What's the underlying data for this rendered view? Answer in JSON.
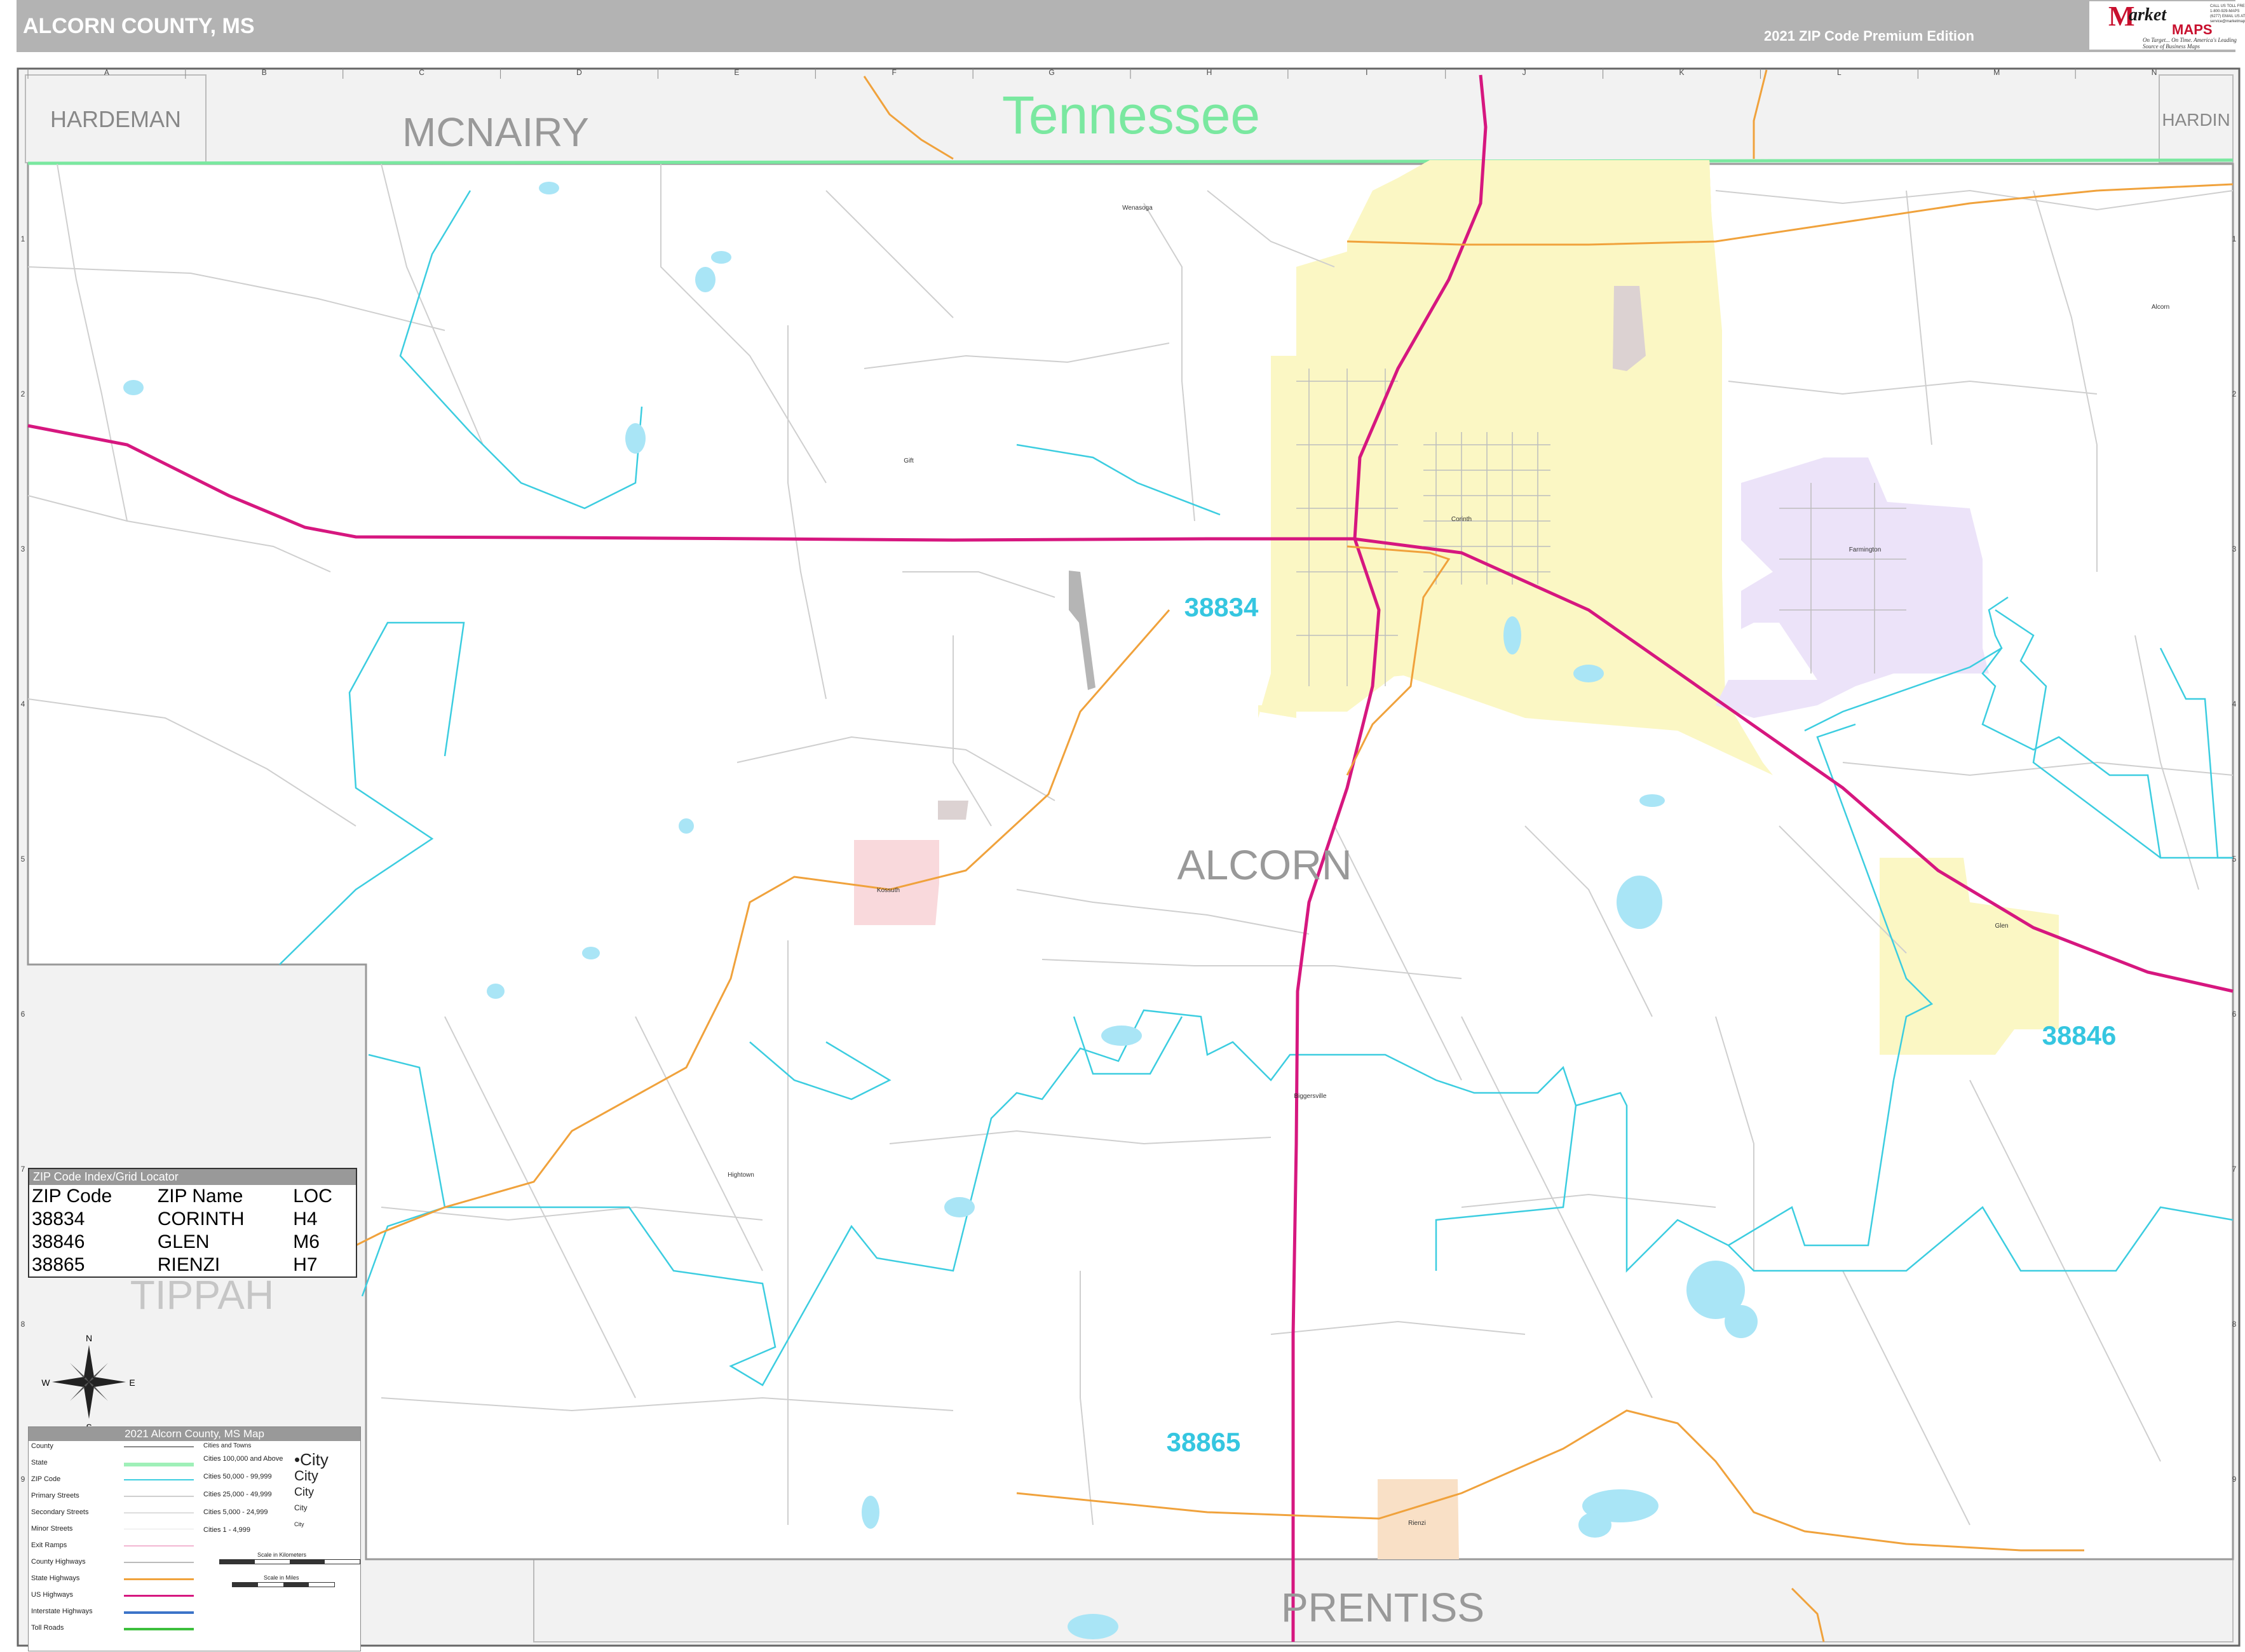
{
  "header": {
    "title": "ALCORN COUNTY, MS",
    "edition": "2021 ZIP Code Premium Edition"
  },
  "logo": {
    "mark": "M",
    "word1": "arket",
    "word2": "MAPS",
    "slogan": "On Target... On Time. America's Leading Source of Business Maps",
    "contact": "CALL US TOLL FREE 1-800-929-MAPS (6277) EMAIL US AT: service@marketmaps.com"
  },
  "grid": {
    "columns": [
      "A",
      "B",
      "C",
      "D",
      "E",
      "F",
      "G",
      "H",
      "I",
      "J",
      "K",
      "L",
      "M",
      "N"
    ],
    "rows": [
      "1",
      "2",
      "3",
      "4",
      "5",
      "6",
      "7",
      "8",
      "9"
    ]
  },
  "regions": {
    "state": "Tennessee",
    "county": "ALCORN",
    "neighbors": [
      "HARDEMAN",
      "MCNAIRY",
      "HARDIN",
      "TIPPAH",
      "PRENTISS"
    ]
  },
  "zip_labels": [
    "38834",
    "38846",
    "38865"
  ],
  "places": [
    "Corinth",
    "Farmington",
    "Kossuth",
    "Glen",
    "Rienzi",
    "Biggersville",
    "Wenasoga",
    "Gift",
    "Hightown",
    "Alcorn"
  ],
  "zip_index": {
    "title": "ZIP Code Index/Grid Locator",
    "headers": [
      "ZIP Code",
      "ZIP Name",
      "LOC"
    ],
    "rows": [
      [
        "38834",
        "CORINTH",
        "H4"
      ],
      [
        "38846",
        "GLEN",
        "M6"
      ],
      [
        "38865",
        "RIENZI",
        "H7"
      ]
    ]
  },
  "compass": {
    "n": "N",
    "s": "S",
    "e": "E",
    "w": "W"
  },
  "legend": {
    "title": "2021 Alcorn County, MS Map",
    "items": [
      "County",
      "State",
      "ZIP Code",
      "Primary Streets",
      "Secondary Streets",
      "Minor Streets",
      "Exit Ramps",
      "County Highways",
      "State Highways",
      "US Highways",
      "Interstate Highways",
      "Toll Roads"
    ],
    "cities_title": "Cities and Towns",
    "city_classes": [
      "Cities 100,000 and Above",
      "Cities 50,000 - 99,999",
      "Cities 25,000 - 49,999",
      "Cities 5,000 - 24,999",
      "Cities 1 - 4,999"
    ],
    "city_samples": [
      "City",
      "City",
      "City",
      "City",
      "City"
    ],
    "scale_km": "Scale in Kilometers",
    "scale_mi": "Scale in Miles"
  },
  "colors": {
    "zip_38834": "#fbf7c4",
    "zip_farmington": "#ece3f9",
    "zip_38846": "#fbf7c4",
    "kossuth": "#f9d9dc",
    "rienzi": "#f9e0c6",
    "zip_boundary": "#3ccde0",
    "us_highway": "#d6177f",
    "state_highway": "#f0a23c",
    "state_line": "#7ae8a0",
    "water": "#a9e5f6",
    "outside": "#f2f2f2"
  }
}
